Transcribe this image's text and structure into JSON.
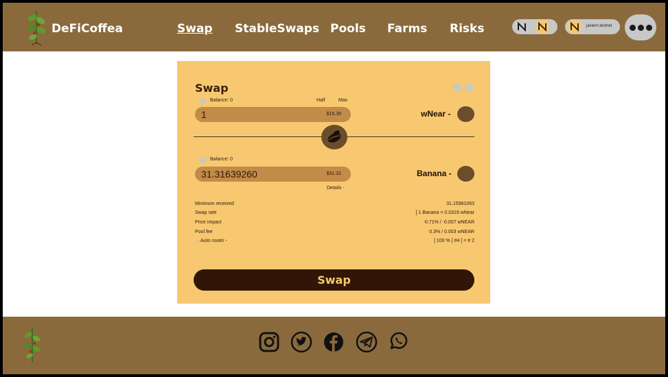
{
  "header": {
    "brand": "DeFiCoffea",
    "nav": [
      "Swap",
      "StableSwaps",
      "Pools",
      "Farms",
      "Risks"
    ],
    "account": "javiern.testnet"
  },
  "swap": {
    "title": "Swap",
    "from": {
      "balance": "Balance: 0",
      "half": "Half",
      "max": "Max",
      "amount": "1",
      "usd": "$15.39",
      "token": "wNear -"
    },
    "to": {
      "balance": "Balance: 0",
      "amount": "31.31639260",
      "usd": "$31.31",
      "token": "Banana -",
      "details": "Details -"
    },
    "details": [
      {
        "label": "Minimum received",
        "value": "31.15981063"
      },
      {
        "label": "Swap rate",
        "value": "] 1 Banana = 0.0319 wNear"
      },
      {
        "label": "Price impact",
        "value": "-0.71% / -0.007 wNEAR"
      },
      {
        "label": "Pool fee",
        "value": "0.3% / 0.003 wNEAR"
      },
      {
        "label": "·  Auto router -",
        "value": "] 100 % [ #4 [ < # 2"
      }
    ],
    "button": "Swap"
  },
  "footer": {
    "social_icons": [
      "instagram-icon",
      "twitter-icon",
      "facebook-icon",
      "telegram-icon",
      "whatsapp-icon"
    ]
  },
  "colors": {
    "header_bg": "#8a6a3c",
    "card_bg": "#f7c870",
    "input_bg": "#c18b48",
    "button_bg": "#311507",
    "button_text": "#f7c870"
  }
}
